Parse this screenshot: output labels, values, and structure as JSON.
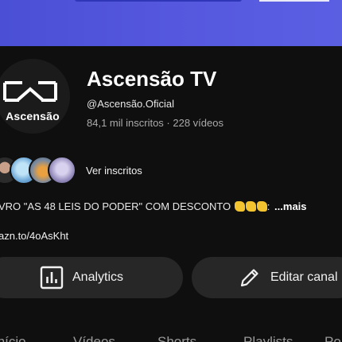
{
  "channel": {
    "avatar_label": "Ascensão",
    "name": "Ascensão TV",
    "handle": "@Ascensão.Oficial",
    "stats": "84,1 mil inscritos · 228 vídeos",
    "see_subscribers": "Ver inscritos",
    "description": "VRO \"AS 48 LEIS DO PODER\" COM DESCONTO",
    "description_more": "...mais",
    "link": "azn.to/4oAsKht"
  },
  "buttons": {
    "analytics": "Analytics",
    "edit": "Editar canal"
  },
  "tabs": [
    "Início",
    "Vídeos",
    "Shorts",
    "Playlists",
    "Po"
  ],
  "colors": {
    "banner": "#5558de",
    "background": "#0f0f0f",
    "button_bg": "#272727"
  }
}
